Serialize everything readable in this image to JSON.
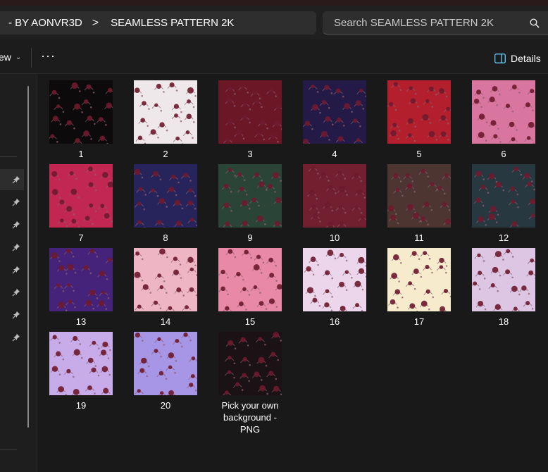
{
  "breadcrumb": {
    "items": [
      "- BY AONVR3D",
      "SEAMLESS PATTERN 2K"
    ],
    "separator": ">"
  },
  "search": {
    "placeholder": "Search SEAMLESS PATTERN 2K",
    "icon": "search-icon"
  },
  "toolbar": {
    "view_label": "ew",
    "more_label": "···",
    "details_label": "Details"
  },
  "files": [
    {
      "name": "1",
      "bg": "#0d0a0c"
    },
    {
      "name": "2",
      "bg": "#efe8ea"
    },
    {
      "name": "3",
      "bg": "#6b1726"
    },
    {
      "name": "4",
      "bg": "#231a48"
    },
    {
      "name": "5",
      "bg": "#b31f2c"
    },
    {
      "name": "6",
      "bg": "#d9769f"
    },
    {
      "name": "7",
      "bg": "#c22752"
    },
    {
      "name": "8",
      "bg": "#27245c"
    },
    {
      "name": "9",
      "bg": "#2a4438"
    },
    {
      "name": "10",
      "bg": "#721f30"
    },
    {
      "name": "11",
      "bg": "#4d3631"
    },
    {
      "name": "12",
      "bg": "#283840"
    },
    {
      "name": "13",
      "bg": "#45237b"
    },
    {
      "name": "14",
      "bg": "#eeb6c5"
    },
    {
      "name": "15",
      "bg": "#e889a8"
    },
    {
      "name": "16",
      "bg": "#ecd6ec"
    },
    {
      "name": "17",
      "bg": "#f6ebcd"
    },
    {
      "name": "18",
      "bg": "#dcc6e3"
    },
    {
      "name": "19",
      "bg": "#c8acea"
    },
    {
      "name": "20",
      "bg": "#a795e6"
    },
    {
      "name": "Pick your own background - PNG",
      "bg": "#1a1214"
    }
  ],
  "colors": {
    "background": "#191919",
    "addressbar": "#202020",
    "field": "#2e2e2e",
    "text": "#ffffff",
    "flower": "#6e1a2e",
    "leaf": "#8a5f72"
  }
}
